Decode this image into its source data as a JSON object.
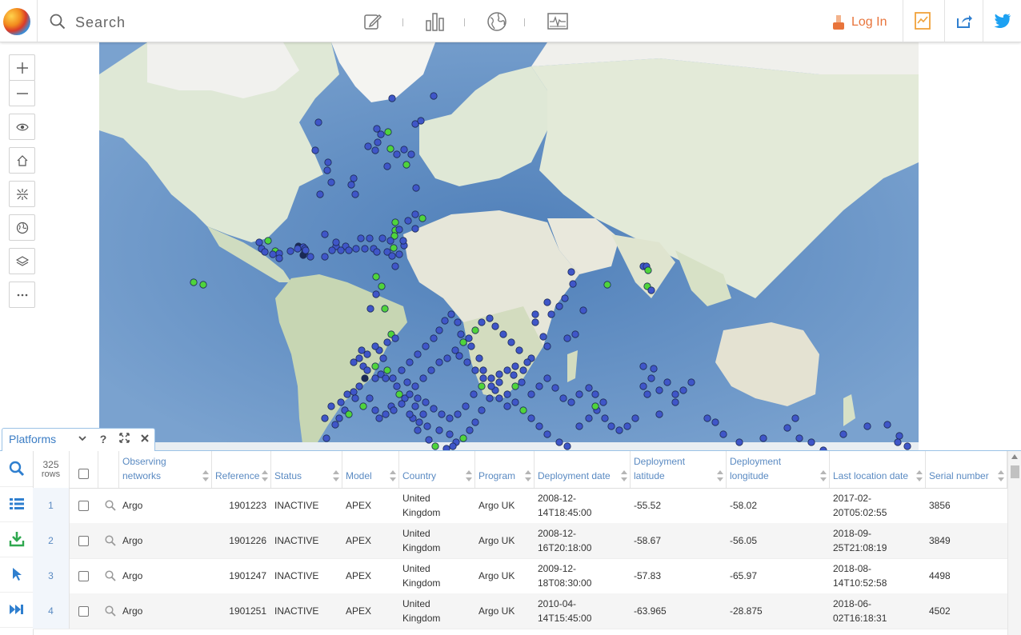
{
  "topbar": {
    "search_placeholder": "Search",
    "tools": [
      "edit-icon",
      "bar-chart-icon",
      "globe-icon",
      "monitor-chart-icon"
    ],
    "login_label": "Log In",
    "login_color": "#e8743b",
    "right_buttons": [
      "report-icon",
      "share-icon",
      "twitter-icon"
    ]
  },
  "map": {
    "marker_colors": {
      "active": "#4fd43b",
      "inactive": "#3f56c8",
      "dark": "#1a2a55"
    },
    "tools": [
      "zoom-in-icon",
      "zoom-out-icon",
      "eye-icon",
      "home-icon",
      "collapse-icon",
      "globe-icon",
      "layers-icon",
      "more-icon"
    ]
  },
  "panel": {
    "tab_label": "Platforms",
    "rows_count": "325",
    "rows_label": "rows",
    "side_tools": [
      "search-icon",
      "list-icon",
      "download-icon",
      "pointer-icon",
      "fast-forward-icon"
    ],
    "columns": [
      {
        "key": "networks",
        "lines": [
          "Observing",
          "networks"
        ]
      },
      {
        "key": "reference",
        "lines": [
          "Reference"
        ]
      },
      {
        "key": "status",
        "lines": [
          "Status"
        ]
      },
      {
        "key": "model",
        "lines": [
          "Model"
        ]
      },
      {
        "key": "country",
        "lines": [
          "Country"
        ]
      },
      {
        "key": "program",
        "lines": [
          "Program"
        ]
      },
      {
        "key": "deploy_date",
        "lines": [
          "Deployment date"
        ]
      },
      {
        "key": "deploy_lat",
        "lines": [
          "Deployment",
          "latitude"
        ]
      },
      {
        "key": "deploy_lon",
        "lines": [
          "Deployment",
          "longitude"
        ]
      },
      {
        "key": "last_loc",
        "lines": [
          "Last location date"
        ]
      },
      {
        "key": "serial",
        "lines": [
          "Serial number"
        ]
      }
    ],
    "rows": [
      {
        "num": "1",
        "networks": "Argo",
        "reference": "1901223",
        "status": "INACTIVE",
        "model": "APEX",
        "country": [
          "United",
          "Kingdom"
        ],
        "program": "Argo UK",
        "deploy_date": [
          "2008-12-",
          "14T18:45:00"
        ],
        "deploy_lat": "-55.52",
        "deploy_lon": "-58.02",
        "last_loc": [
          "2017-02-",
          "20T05:02:55"
        ],
        "serial": "3856"
      },
      {
        "num": "2",
        "networks": "Argo",
        "reference": "1901226",
        "status": "INACTIVE",
        "model": "APEX",
        "country": [
          "United",
          "Kingdom"
        ],
        "program": "Argo UK",
        "deploy_date": [
          "2008-12-",
          "16T20:18:00"
        ],
        "deploy_lat": "-58.67",
        "deploy_lon": "-56.05",
        "last_loc": [
          "2018-09-",
          "25T21:08:19"
        ],
        "serial": "3849"
      },
      {
        "num": "3",
        "networks": "Argo",
        "reference": "1901247",
        "status": "INACTIVE",
        "model": "APEX",
        "country": [
          "United",
          "Kingdom"
        ],
        "program": "Argo UK",
        "deploy_date": [
          "2009-12-",
          "18T08:30:00"
        ],
        "deploy_lat": "-57.83",
        "deploy_lon": "-65.97",
        "last_loc": [
          "2018-08-",
          "14T10:52:58"
        ],
        "serial": "4498"
      },
      {
        "num": "4",
        "networks": "Argo",
        "reference": "1901251",
        "status": "INACTIVE",
        "model": "APEX",
        "country": [
          "United",
          "Kingdom"
        ],
        "program": "Argo UK",
        "deploy_date": [
          "2010-04-",
          "14T15:45:00"
        ],
        "deploy_lat": "-63.965",
        "deploy_lon": "-28.875",
        "last_loc": [
          "2018-06-",
          "02T16:18:31"
        ],
        "serial": "4502"
      }
    ]
  }
}
